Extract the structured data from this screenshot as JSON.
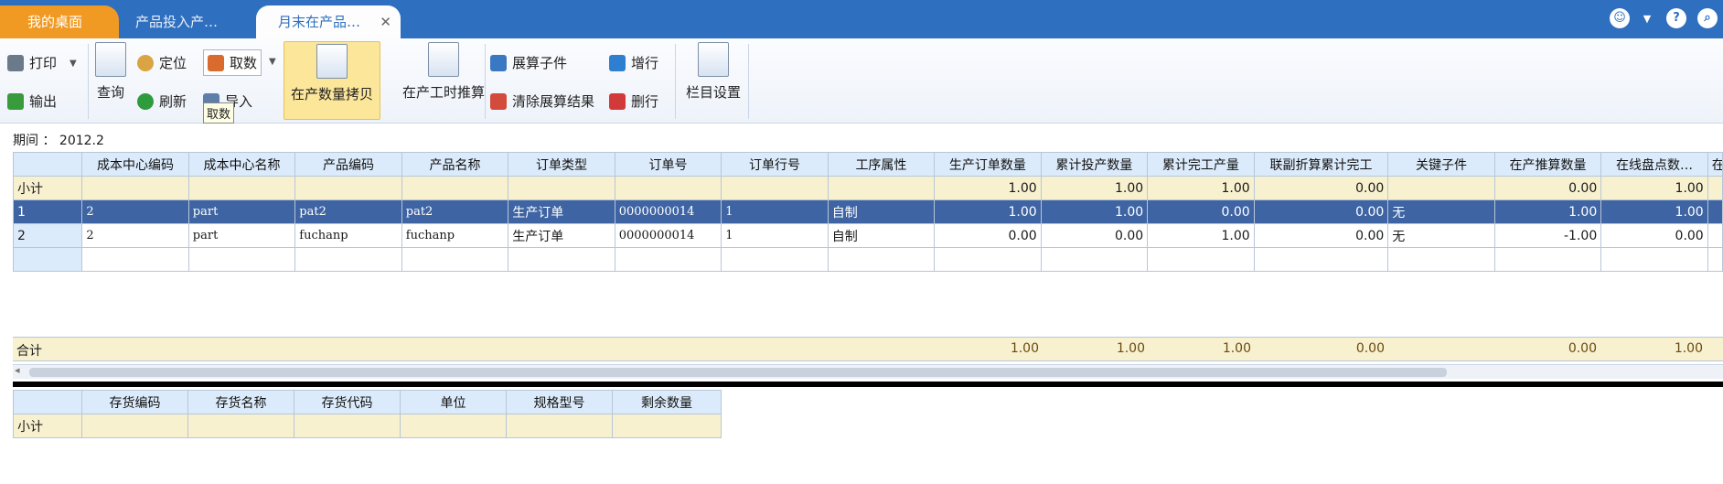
{
  "tabs": [
    {
      "label": "我的桌面"
    },
    {
      "label": "产品投入产…"
    },
    {
      "label": "月末在产品…"
    }
  ],
  "tab_close": "✕",
  "toolbar": {
    "print": "打印",
    "export": "输出",
    "query": "查询",
    "locate": "定位",
    "refresh": "刷新",
    "take": "取数",
    "import": "导入",
    "take_tooltip": "取数",
    "wip_copy": "在产数量拷贝",
    "wip_hours": "在产工时推算",
    "expand_child": "展算子件",
    "clear_expand": "清除展算结果",
    "add_row": "增行",
    "del_row": "删行",
    "column_settings": "栏目设置"
  },
  "period": {
    "label": "期间",
    "sep": "：",
    "value": "2012.2"
  },
  "main_grid": {
    "columns": [
      "成本中心编码",
      "成本中心名称",
      "产品编码",
      "产品名称",
      "订单类型",
      "订单号",
      "订单行号",
      "工序属性",
      "生产订单数量",
      "累计投产数量",
      "累计完工产量",
      "联副折算累计完工",
      "关键子件",
      "在产推算数量",
      "在线盘点数…",
      "在"
    ],
    "subtotal": {
      "label": "小计",
      "values": [
        "",
        "",
        "",
        "",
        "",
        "",
        "",
        "",
        "1.00",
        "1.00",
        "1.00",
        "0.00",
        "",
        "0.00",
        "1.00",
        ""
      ]
    },
    "rows": [
      {
        "no": "1",
        "cells": [
          "2",
          "part",
          "pat2",
          "pat2",
          "生产订单",
          "0000000014",
          "1",
          "自制",
          "1.00",
          "1.00",
          "0.00",
          "0.00",
          "无",
          "1.00",
          "1.00",
          ""
        ]
      },
      {
        "no": "2",
        "cells": [
          "2",
          "part",
          "fuchanp",
          "fuchanp",
          "生产订单",
          "0000000014",
          "1",
          "自制",
          "0.00",
          "0.00",
          "1.00",
          "0.00",
          "无",
          "-1.00",
          "0.00",
          ""
        ]
      }
    ],
    "total": {
      "label": "合计",
      "values": [
        "1.00",
        "1.00",
        "1.00",
        "0.00",
        "0.00",
        "1.00"
      ]
    }
  },
  "sub_grid": {
    "columns": [
      "存货编码",
      "存货名称",
      "存货代码",
      "单位",
      "规格型号",
      "剩余数量"
    ],
    "subtotal_label": "小计"
  }
}
